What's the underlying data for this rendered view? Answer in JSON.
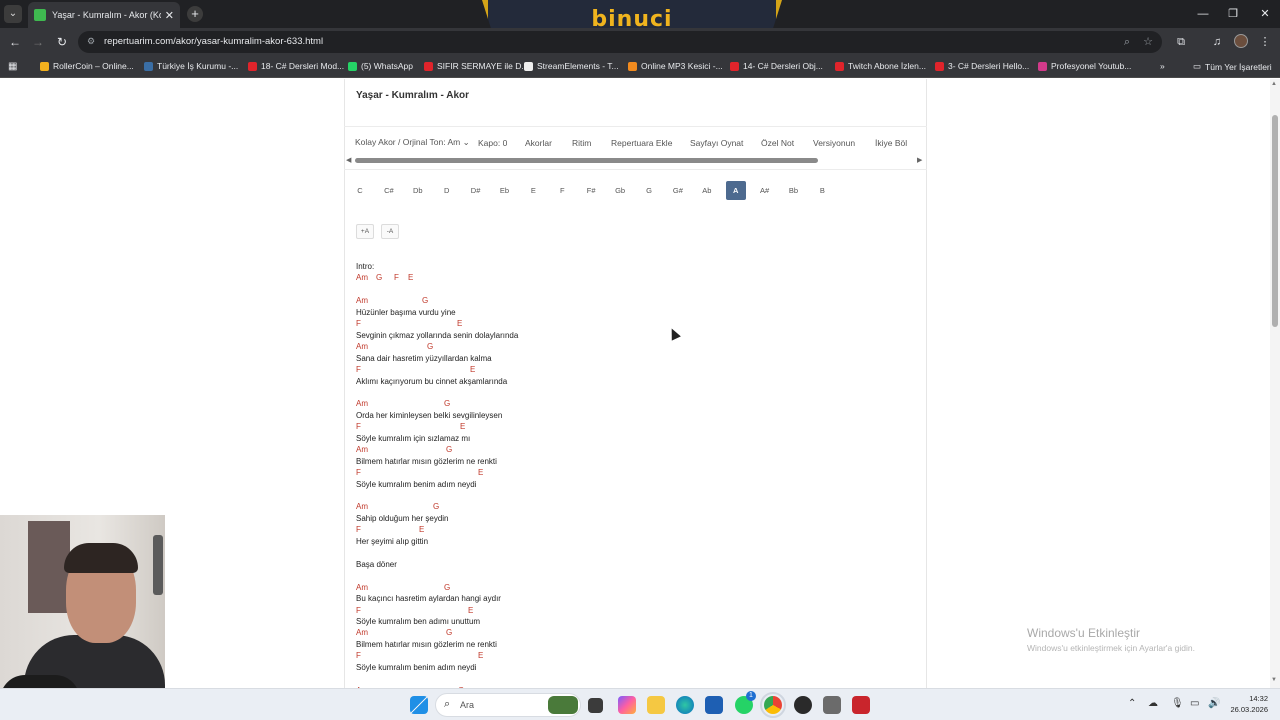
{
  "browser": {
    "tab_title": "Yaşar - Kumralım - Akor (Kolay",
    "url": "repertuarim.com/akor/yasar-kumralim-akor-633.html",
    "banner_text": "binuci"
  },
  "bookmarks": [
    {
      "label": "RollerCoin – Online...",
      "color": "#f2b01e"
    },
    {
      "label": "Türkiye İş Kurumu -...",
      "color": "#3a6ea5"
    },
    {
      "label": "18- C# Dersleri Mod...",
      "color": "#e0242b"
    },
    {
      "label": "(5) WhatsApp",
      "color": "#25d366"
    },
    {
      "label": "SIFIR SERMAYE ile D...",
      "color": "#e0242b"
    },
    {
      "label": "StreamElements - T...",
      "color": "#eeeeee"
    },
    {
      "label": "Online MP3 Kesici -...",
      "color": "#f28b1e"
    },
    {
      "label": "14- C# Dersleri Obj...",
      "color": "#e0242b"
    },
    {
      "label": "Twitch Abone İzlen...",
      "color": "#e0242b"
    },
    {
      "label": "3- C# Dersleri Hello...",
      "color": "#e0242b"
    },
    {
      "label": "Profesyonel Youtub...",
      "color": "#d23a8a"
    }
  ],
  "bookmarks_folder": "Tüm Yer İşaretleri",
  "page": {
    "song_title": "Yaşar - Kumralım - Akor",
    "controls": {
      "tone_select": "Kolay Akor / Orjinal Ton: Am",
      "capo": "Kapo: 0",
      "chords": "Akorlar",
      "rhythm": "Ritim",
      "add_repertoire": "Repertuara Ekle",
      "play_page": "Sayfayı Oynat",
      "private_note": "Özel Not",
      "version": "Versiyonun",
      "split": "İkiye Böl"
    },
    "keys": [
      "C",
      "C#",
      "Db",
      "D",
      "D#",
      "Eb",
      "E",
      "F",
      "F#",
      "Gb",
      "G",
      "G#",
      "Ab",
      "A",
      "A#",
      "Bb",
      "B"
    ],
    "active_key": "A",
    "font_increase": "+A",
    "font_decrease": "-A",
    "intro_label": "Intro:",
    "intro_chords": [
      "Am",
      "G",
      "F",
      "E"
    ],
    "lyrics": [
      {
        "type": "chords",
        "items": [
          [
            "Am",
            0
          ],
          [
            "G",
            66
          ]
        ]
      },
      {
        "type": "text",
        "text": "Hüzünler başıma vurdu yine"
      },
      {
        "type": "chords",
        "items": [
          [
            "F",
            0
          ],
          [
            "E",
            101
          ]
        ]
      },
      {
        "type": "text",
        "text": "Sevginin çıkmaz yollarında senin dolaylarında"
      },
      {
        "type": "chords",
        "items": [
          [
            "Am",
            0
          ],
          [
            "G",
            71
          ]
        ]
      },
      {
        "type": "text",
        "text": "Sana dair hasretim yüzyıllardan kalma"
      },
      {
        "type": "chords",
        "items": [
          [
            "F",
            0
          ],
          [
            "E",
            114
          ]
        ]
      },
      {
        "type": "text",
        "text": "Aklımı kaçırıyorum bu cinnet akşamlarında"
      },
      {
        "type": "gap"
      },
      {
        "type": "chords",
        "items": [
          [
            "Am",
            0
          ],
          [
            "G",
            88
          ]
        ]
      },
      {
        "type": "text",
        "text": "Orda her kiminleysen belki sevgilinleysen"
      },
      {
        "type": "chords",
        "items": [
          [
            "F",
            0
          ],
          [
            "E",
            104
          ]
        ]
      },
      {
        "type": "text",
        "text": "Söyle kumralım için sızlamaz mı"
      },
      {
        "type": "chords",
        "items": [
          [
            "Am",
            0
          ],
          [
            "G",
            90
          ]
        ]
      },
      {
        "type": "text",
        "text": "Bilmem hatırlar mısın gözlerim ne renkti"
      },
      {
        "type": "chords",
        "items": [
          [
            "F",
            0
          ],
          [
            "E",
            122
          ]
        ]
      },
      {
        "type": "text",
        "text": "Söyle kumralım benim adım neydi"
      },
      {
        "type": "gap"
      },
      {
        "type": "chords",
        "items": [
          [
            "Am",
            0
          ],
          [
            "G",
            77
          ]
        ]
      },
      {
        "type": "text",
        "text": "Sahip olduğum her şeydin"
      },
      {
        "type": "chords",
        "items": [
          [
            "F",
            0
          ],
          [
            "E",
            63
          ]
        ]
      },
      {
        "type": "text",
        "text": "Her şeyimi alıp gittin"
      },
      {
        "type": "gap"
      },
      {
        "type": "text",
        "text": "Başa döner"
      },
      {
        "type": "gap"
      },
      {
        "type": "chords",
        "items": [
          [
            "Am",
            0
          ],
          [
            "G",
            88
          ]
        ]
      },
      {
        "type": "text",
        "text": "Bu kaçıncı hasretim aylardan hangi aydır"
      },
      {
        "type": "chords",
        "items": [
          [
            "F",
            0
          ],
          [
            "E",
            112
          ]
        ]
      },
      {
        "type": "text",
        "text": "Söyle kumralım ben adımı unuttum"
      },
      {
        "type": "chords",
        "items": [
          [
            "Am",
            0
          ],
          [
            "G",
            90
          ]
        ]
      },
      {
        "type": "text",
        "text": "Bilmem hatırlar mısın gözlerim ne renkti"
      },
      {
        "type": "chords",
        "items": [
          [
            "F",
            0
          ],
          [
            "E",
            122
          ]
        ]
      },
      {
        "type": "text",
        "text": "Söyle kumralım benim adım neydi"
      },
      {
        "type": "gap"
      },
      {
        "type": "chords",
        "items": [
          [
            "Am",
            0
          ],
          [
            "G",
            102
          ]
        ]
      }
    ]
  },
  "windows": {
    "activation_title": "Windows'u Etkinleştir",
    "activation_sub": "Windows'u etkinleştirmek için Ayarlar'a gidin."
  },
  "taskbar": {
    "search_placeholder": "Ara",
    "time": "14:32",
    "date": "26.03.2026",
    "whatsapp_badge": "1"
  }
}
